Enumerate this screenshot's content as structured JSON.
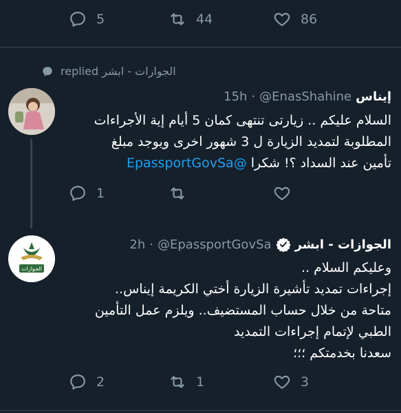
{
  "top_actions": {
    "reply_count": "5",
    "retweet_count": "44",
    "like_count": "86"
  },
  "replied_banner": {
    "text": "الجوازات - ابشر replied"
  },
  "tweet1": {
    "display_name": "إيناس",
    "handle": "@EnasShahine",
    "separator": "·",
    "time": "15h",
    "text_main": "السلام عليكم .. زيارتى تنتهى كمان 5 أيام إية الأجراءات\nالمطلوبة لتمديد الزيارة ل 3 شهور اخرى  ويوجد مبلغ\nتأمين عند السداد ؟! شكرا ",
    "text_mention": "@EpassportGovSa",
    "reply_count": "1",
    "retweet_count": "",
    "like_count": ""
  },
  "tweet2": {
    "display_name": "الجوازات - ابشر",
    "handle": "@EpassportGovSa",
    "separator": "·",
    "time": "2h",
    "avatar_text": "الجوازات",
    "text": "وعليكم السلام ..\nإجراءات تمديد تأشيرة الزيارة أختي الكريمة إيناس..\nمتاحة من خلال حساب المستضيف.. ويلزم عمل التأمين\nالطبي لإتمام إجراءات التمديد\nسعدنا بخدمتكم ؛؛؛",
    "reply_count": "2",
    "retweet_count": "1",
    "like_count": "3"
  },
  "colors": {
    "background": "#15202b",
    "secondary": "#8899a6",
    "link": "#1da1f2",
    "divider": "#38444d",
    "thread_line": "#38444d"
  }
}
